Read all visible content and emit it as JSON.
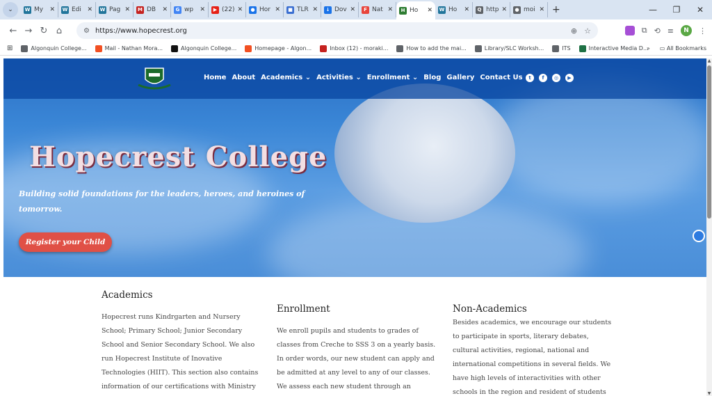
{
  "browser": {
    "tabs": [
      {
        "label": "My",
        "color": "#21759b",
        "glyph": "W"
      },
      {
        "label": "Edi",
        "color": "#21759b",
        "glyph": "W"
      },
      {
        "label": "Pag",
        "color": "#21759b",
        "glyph": "W"
      },
      {
        "label": "DB",
        "color": "#c5221f",
        "glyph": "M"
      },
      {
        "label": "wp",
        "color": "#4285f4",
        "glyph": "G"
      },
      {
        "label": "(22)",
        "color": "#e62117",
        "glyph": "▶"
      },
      {
        "label": "Hor",
        "color": "#1a73e8",
        "glyph": "●"
      },
      {
        "label": "TLR",
        "color": "#3b6fd1",
        "glyph": "■"
      },
      {
        "label": "Dov",
        "color": "#1a73e8",
        "glyph": "↓"
      },
      {
        "label": "Nat",
        "color": "#e8453c",
        "glyph": "F"
      },
      {
        "label": "Ho",
        "color": "#2e7d32",
        "glyph": "H",
        "active": true
      },
      {
        "label": "Ho",
        "color": "#21759b",
        "glyph": "W"
      },
      {
        "label": "http",
        "color": "#5f6368",
        "glyph": "Q"
      },
      {
        "label": "moi",
        "color": "#5f6368",
        "glyph": "●"
      }
    ],
    "url": "https://www.hopecrest.org",
    "avatar_initial": "N",
    "bookmarks": [
      {
        "label": "Algonquin College...",
        "color": "#5f6368"
      },
      {
        "label": "Mail - Nathan Mora...",
        "color": "#f25022"
      },
      {
        "label": "Algonquin College...",
        "color": "#111111"
      },
      {
        "label": "Homepage - Algon...",
        "color": "#f25022"
      },
      {
        "label": "Inbox (12) - moraki...",
        "color": "#c5221f"
      },
      {
        "label": "How to add the mai...",
        "color": "#5f6368"
      },
      {
        "label": "Library/SLC Worksh...",
        "color": "#5f6368"
      },
      {
        "label": "ITS",
        "color": "#5f6368"
      },
      {
        "label": "Interactive Media D...",
        "color": "#1e7145"
      }
    ],
    "all_bookmarks": "All Bookmarks",
    "more": "»"
  },
  "site": {
    "nav": [
      "Home",
      "About",
      "Academics ⌄",
      "Activities ⌄",
      "Enrollment ⌄",
      "Blog",
      "Gallery",
      "Contact Us"
    ],
    "title": "Hopecrest College",
    "tagline": "Building solid foundations for the leaders, heroes, and heroines of tomorrow.",
    "cta": "Register your Child",
    "columns": {
      "academics": {
        "heading": "Academics",
        "body": "Hopecrest runs Kindrgarten and Nursery School; Primary School; Junior Secondary School and Senior Secondary School. We also run Hopecrest Institute of Inovative Technologies (HIIT). This section also contains information of our certifications with Ministry"
      },
      "enrollment": {
        "heading": "Enrollment",
        "body": "We enroll pupils and students to grades of classes from Creche to SSS 3 on a yearly basis. In order words, our new student can apply and be admitted at any level to any of our classes. We assess each new student through an"
      },
      "nonacademics": {
        "heading": "Non-Academics",
        "body": "Besides academics, we encourage our students to participate in sports, literary debates, cultural activities, regional, national and international competitions in several fields. We have high levels of interactivities with other schools in the region and resident of students"
      }
    }
  }
}
